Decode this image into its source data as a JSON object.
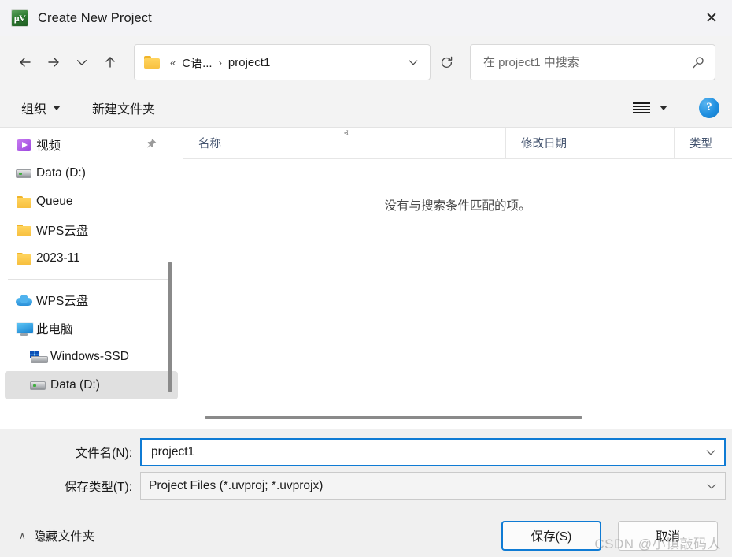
{
  "window": {
    "title": "Create New Project",
    "app_icon": "uvision-icon",
    "close_label": "✕"
  },
  "nav": {
    "back_label": "←",
    "forward_label": "→",
    "recent_label": "∨",
    "up_label": "↑",
    "refresh_label": "↻",
    "address": {
      "folder_icon": "folder-icon",
      "overflow": "«",
      "crumbs": [
        {
          "label": "C语..."
        },
        {
          "label": "project1"
        }
      ],
      "separator": "›",
      "dropdown": "∨"
    },
    "search": {
      "placeholder": "在 project1 中搜索",
      "value": "",
      "icon": "search-icon"
    }
  },
  "commandbar": {
    "organize_label": "组织",
    "new_folder_label": "新建文件夹",
    "view_label": "view-list-icon",
    "help_label": "?"
  },
  "sidebar": {
    "groups": [
      {
        "items": [
          {
            "label": "视频",
            "icon": "video-folder-icon",
            "pinned": true,
            "pin_glyph": "📌",
            "selected": false,
            "indent": false
          },
          {
            "label": "Data (D:)",
            "icon": "drive-icon",
            "pinned": false,
            "selected": false,
            "indent": false
          },
          {
            "label": "Queue",
            "icon": "folder-icon",
            "pinned": false,
            "selected": false,
            "indent": false
          },
          {
            "label": "WPS云盘",
            "icon": "folder-icon",
            "pinned": false,
            "selected": false,
            "indent": false
          },
          {
            "label": "2023-11",
            "icon": "folder-icon",
            "pinned": false,
            "selected": false,
            "indent": false
          }
        ]
      },
      {
        "items": [
          {
            "label": "WPS云盘",
            "icon": "cloud-icon",
            "pinned": false,
            "selected": false,
            "indent": false
          },
          {
            "label": "此电脑",
            "icon": "this-pc-icon",
            "pinned": false,
            "selected": false,
            "indent": false
          },
          {
            "label": "Windows-SSD",
            "icon": "ssd-drive-icon",
            "pinned": false,
            "selected": false,
            "indent": true
          },
          {
            "label": "Data (D:)",
            "icon": "drive-icon",
            "pinned": false,
            "selected": true,
            "indent": true
          }
        ]
      }
    ]
  },
  "filelist": {
    "columns": [
      {
        "label": "名称",
        "sorted": true,
        "sort_glyph": "ⱏ"
      },
      {
        "label": "修改日期",
        "sorted": false
      },
      {
        "label": "类型",
        "sorted": false
      }
    ],
    "empty_message": "没有与搜索条件匹配的项。",
    "rows": []
  },
  "form": {
    "filename_label": "文件名(N):",
    "filename_value": "project1",
    "filetype_label": "保存类型(T):",
    "filetype_value": "Project Files (*.uvproj; *.uvprojx)",
    "dropdown_glyph": "∨"
  },
  "actions": {
    "hide_folders_label": "隐藏文件夹",
    "hide_folders_chevron": "∧",
    "save_label": "保存(S)",
    "cancel_label": "取消"
  },
  "watermark": "CSDN @小镇敲码人",
  "colors": {
    "accent": "#0f7bd4",
    "header_text": "#44546f",
    "folder": "#f7bf3e",
    "selection": "#e0e0e0"
  }
}
